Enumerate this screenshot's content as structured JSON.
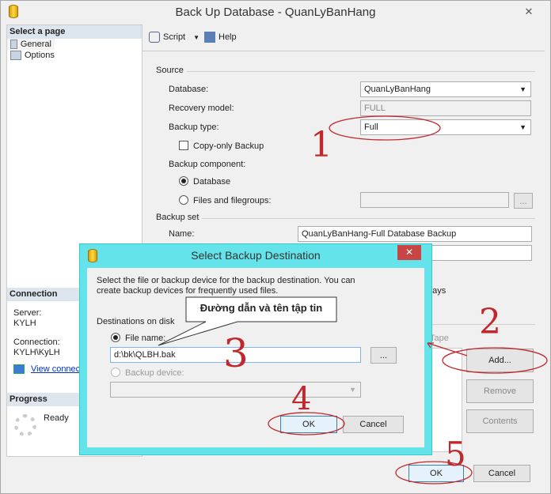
{
  "window": {
    "title": "Back Up Database - QuanLyBanHang",
    "close": "✕"
  },
  "sidebar": {
    "header": "Select a page",
    "items": [
      {
        "label": "General"
      },
      {
        "label": "Options"
      }
    ]
  },
  "connection": {
    "header": "Connection",
    "server_label": "Server:",
    "server": "KYLH",
    "connection_label": "Connection:",
    "connection": "KYLH\\KyLH",
    "view_link": "View connec"
  },
  "progress": {
    "header": "Progress",
    "status": "Ready"
  },
  "toolbar": {
    "script": "Script",
    "help": "Help"
  },
  "source": {
    "group": "Source",
    "database_label": "Database:",
    "database": "QuanLyBanHang",
    "recovery_label": "Recovery model:",
    "recovery": "FULL",
    "type_label": "Backup type:",
    "type": "Full",
    "copy_only": "Copy-only Backup",
    "component_label": "Backup component:",
    "component_database": "Database",
    "component_files": "Files and filegroups:",
    "browse": "..."
  },
  "backup_set": {
    "group": "Backup set",
    "name_label": "Name:",
    "name": "QuanLyBanHang-Full Database Backup",
    "days": "days"
  },
  "destination": {
    "tape": "Tape",
    "add": "Add...",
    "remove": "Remove",
    "contents": "Contents"
  },
  "footer": {
    "ok": "OK",
    "cancel": "Cancel"
  },
  "dialog": {
    "title": "Select Backup Destination",
    "close": "✕",
    "description": "Select the file or backup device for the backup destination. You can create backup devices for frequently used files.",
    "group": "Destinations on disk",
    "file_name_label": "File name:",
    "file_name": "d:\\bk\\QLBH.bak",
    "browse": "...",
    "device_label": "Backup device:",
    "ok": "OK",
    "cancel": "Cancel"
  },
  "annotations": {
    "callout": "Đường dẫn và tên tập tin",
    "numbers": [
      "1",
      "2",
      "3",
      "4",
      "5"
    ],
    "color": "#c0282d"
  }
}
